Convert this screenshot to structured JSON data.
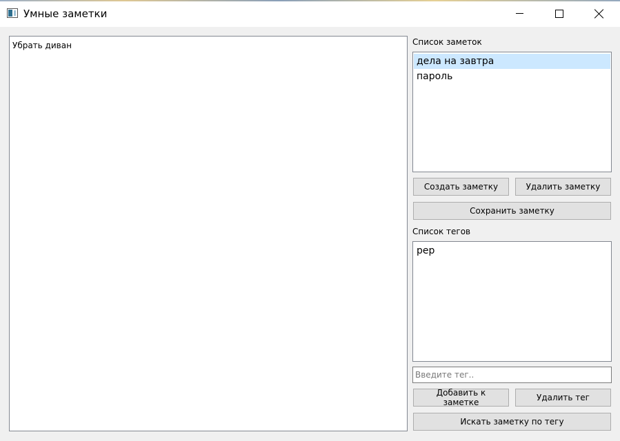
{
  "window": {
    "title": "Умные заметки",
    "icon": "app-window-icon",
    "controls": {
      "minimize": "minimize-icon",
      "maximize": "maximize-icon",
      "close": "close-icon"
    }
  },
  "editor": {
    "text": "Убрать диван"
  },
  "notes": {
    "label": "Список заметок",
    "items": [
      {
        "label": "дела на завтра",
        "selected": true
      },
      {
        "label": "пароль",
        "selected": false
      }
    ],
    "create_label": "Создать заметку",
    "delete_label": "Удалить заметку",
    "save_label": "Сохранить заметку"
  },
  "tags": {
    "label": "Список тегов",
    "items": [
      {
        "label": "рер"
      }
    ],
    "input_placeholder": "Введите тег..",
    "input_value": "",
    "add_label": "Добавить к заметке",
    "delete_label": "Удалить тег",
    "search_label": "Искать заметку по тегу"
  },
  "colors": {
    "selection": "#cce8ff",
    "button_face": "#e1e1e1",
    "border": "#828790"
  }
}
